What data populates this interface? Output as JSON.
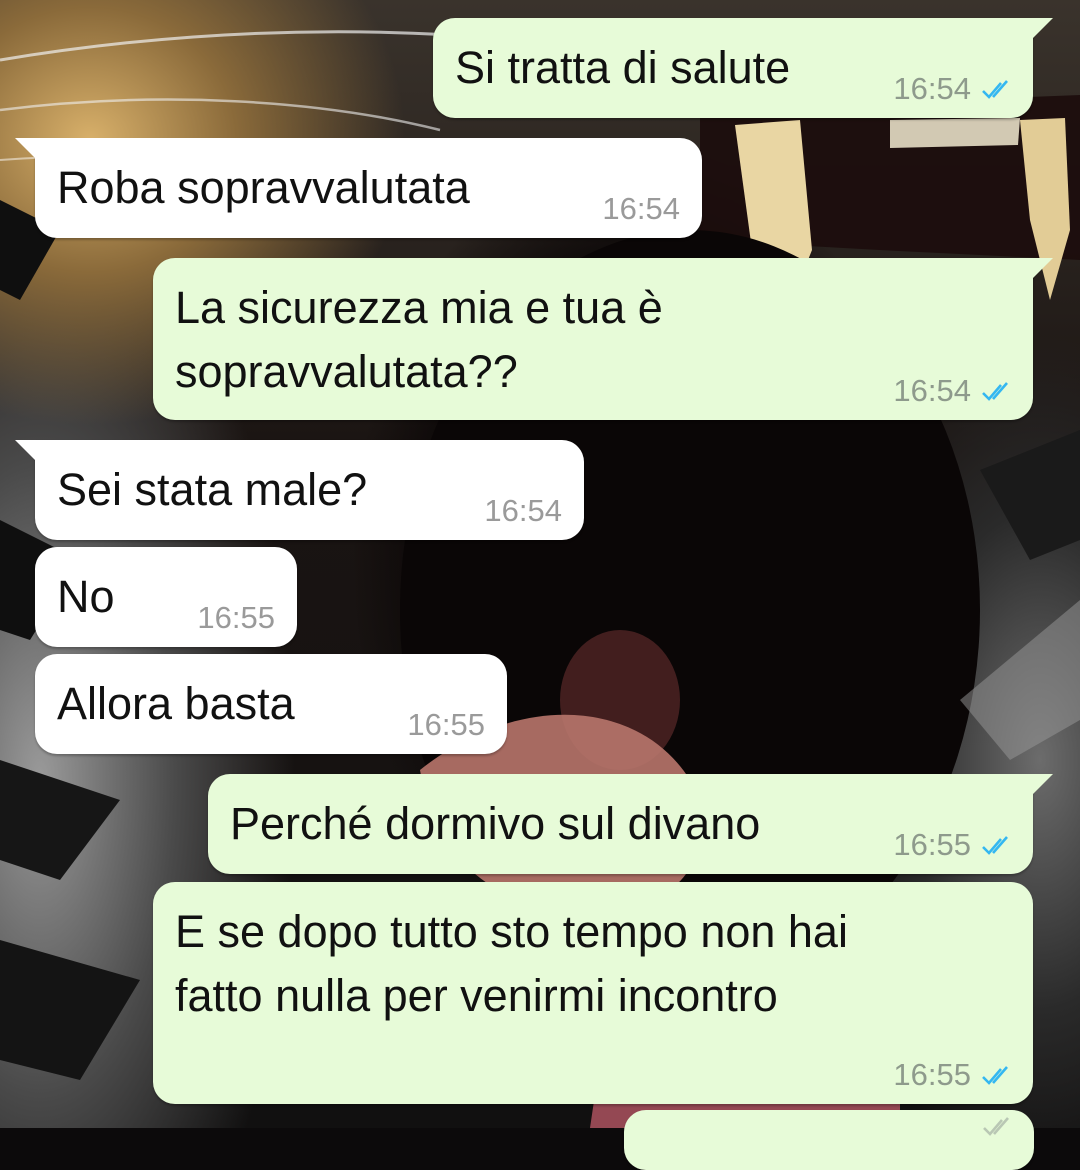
{
  "theme": {
    "outgoing_bubble_color": "#e7fbd8",
    "incoming_bubble_color": "#ffffff",
    "read_tick_color": "#34b7f1",
    "timestamp_color": "#8e9a8c"
  },
  "wallpaper": {
    "icon": "tiger-wallpaper"
  },
  "messages": [
    {
      "direction": "outgoing",
      "text": "Si tratta di salute",
      "time": "16:54",
      "status": "read"
    },
    {
      "direction": "incoming",
      "text": "Roba sopravvalutata",
      "time": "16:54"
    },
    {
      "direction": "outgoing",
      "text_lines": [
        "La sicurezza mia e tua è",
        "sopravvalutata??"
      ],
      "time": "16:54",
      "status": "read"
    },
    {
      "direction": "incoming",
      "text": "Sei stata male?",
      "time": "16:54"
    },
    {
      "direction": "incoming",
      "text": "No",
      "time": "16:55"
    },
    {
      "direction": "incoming",
      "text": "Allora basta",
      "time": "16:55"
    },
    {
      "direction": "outgoing",
      "text": "Perché dormivo sul divano",
      "time": "16:55",
      "status": "read"
    },
    {
      "direction": "outgoing",
      "text_lines": [
        "E se dopo tutto sto tempo non hai",
        "fatto nulla per venirmi incontro"
      ],
      "time": "16:55",
      "status": "read"
    }
  ]
}
